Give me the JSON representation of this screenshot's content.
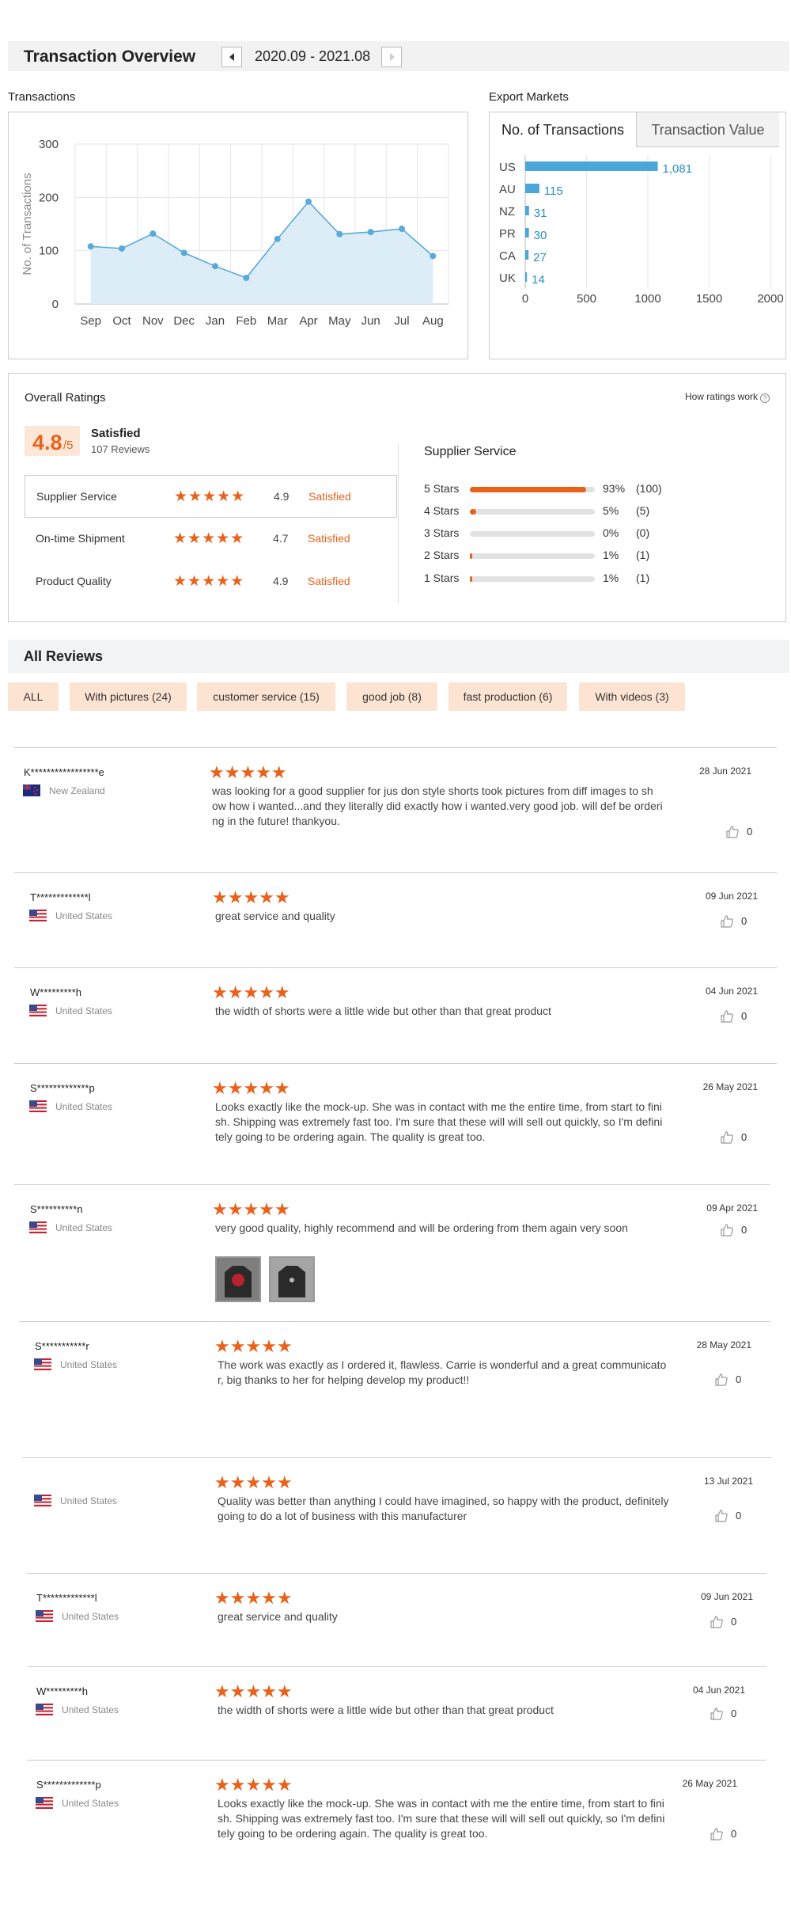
{
  "overview": {
    "title": "Transaction Overview",
    "range": "2020.09 - 2021.08"
  },
  "transactions": {
    "label": "Transactions",
    "chart_data": {
      "type": "area",
      "ylabel": "No. of Transactions",
      "xlabel": "",
      "categories": [
        "Sep",
        "Oct",
        "Nov",
        "Dec",
        "Jan",
        "Feb",
        "Mar",
        "Apr",
        "May",
        "Jun",
        "Jul",
        "Aug"
      ],
      "values": [
        108,
        104,
        132,
        96,
        71,
        49,
        122,
        192,
        131,
        135,
        141,
        90
      ],
      "yticks": [
        "0",
        "100",
        "200",
        "300"
      ],
      "ylim": [
        0,
        300
      ],
      "grid": true,
      "color": "#5aaad8",
      "fill": "#dcedf8"
    }
  },
  "export": {
    "label": "Export Markets",
    "tab_active": "No. of Transactions",
    "tab_inactive": "Transaction Value",
    "chart_data": {
      "type": "bar",
      "orientation": "horizontal",
      "categories": [
        "US",
        "AU",
        "NZ",
        "PR",
        "CA",
        "UK"
      ],
      "values": [
        1081,
        115,
        31,
        30,
        27,
        14
      ],
      "value_labels": [
        "1,081",
        "115",
        "31",
        "30",
        "27",
        "14"
      ],
      "xticks": [
        "0",
        "500",
        "1000",
        "1500",
        "2000"
      ],
      "xlim": [
        0,
        2000
      ],
      "color": "#4aa7d8"
    }
  },
  "ratings": {
    "title": "Overall Ratings",
    "how_link": "How ratings work",
    "help_icon": "?",
    "score": "4.8",
    "score_denominator": "/5",
    "satisfaction": "Satisfied",
    "review_count": "107 Reviews",
    "categories": [
      {
        "name": "Supplier Service",
        "score": "4.9",
        "label": "Satisfied",
        "stars": "★★★★★",
        "rating": 4.9
      },
      {
        "name": "On-time Shipment",
        "score": "4.7",
        "label": "Satisfied",
        "stars": "★★★★★",
        "rating": 4.7
      },
      {
        "name": "Product Quality",
        "score": "4.9",
        "label": "Satisfied",
        "stars": "★★★★★",
        "rating": 4.9
      }
    ],
    "supplier_title": "Supplier Service",
    "distribution": [
      {
        "label": "5 Stars",
        "pct": "93%",
        "count": "(100)",
        "fraction": 0.93
      },
      {
        "label": "4 Stars",
        "pct": "5%",
        "count": "(5)",
        "fraction": 0.05
      },
      {
        "label": "3 Stars",
        "pct": "0%",
        "count": "(0)",
        "fraction": 0.0
      },
      {
        "label": "2 Stars",
        "pct": "1%",
        "count": "(1)",
        "fraction": 0.01
      },
      {
        "label": "1 Stars",
        "pct": "1%",
        "count": "(1)",
        "fraction": 0.01
      }
    ]
  },
  "reviews_section": {
    "title": "All Reviews",
    "filters": [
      "ALL",
      "With pictures (24)",
      "customer service (15)",
      "good job (8)",
      "fast production (6)",
      "With videos (3)"
    ]
  },
  "reviews": [
    {
      "name": "K*****************e",
      "country": "New Zealand",
      "flag": "nz-flag",
      "stars": "★★★★★",
      "date": "28 Jun 2021",
      "likes": "0",
      "lines": [
        "was looking for a good supplier for jus don style shorts took pictures from diff images to sh",
        "ow how i wanted...and they literally did exactly how i wanted.very good job. will def be orderi",
        "ng in the future! thankyou."
      ]
    },
    {
      "name": "T*************l",
      "country": "United States",
      "flag": "us-flag",
      "stars": "★★★★★",
      "date": "09 Jun 2021",
      "likes": "0",
      "lines": [
        "great service and quality"
      ]
    },
    {
      "name": "W*********h",
      "country": "United States",
      "flag": "us-flag",
      "stars": "★★★★★",
      "date": "04 Jun 2021",
      "likes": "0",
      "lines": [
        "the width of shorts were a little wide but other than that great product"
      ]
    },
    {
      "name": "S*************p",
      "country": "United States",
      "flag": "us-flag",
      "stars": "★★★★★",
      "date": "26 May 2021",
      "likes": "0",
      "lines": [
        "Looks exactly like the mock-up. She was in contact with me the entire time, from start to fini",
        "sh. Shipping was extremely fast too. I'm sure that these will will sell out quickly, so I'm defini",
        "tely going to be ordering again. The quality is great too."
      ]
    },
    {
      "name": "S**********n",
      "country": "United States",
      "flag": "us-flag",
      "stars": "★★★★★",
      "date": "09 Apr 2021",
      "likes": "0",
      "lines": [
        "very good quality, highly recommend and will be ordering from them again very soon"
      ]
    },
    {
      "name": "S***********r",
      "country": "United States",
      "flag": "us-flag",
      "stars": "★★★★★",
      "date": "28 May 2021",
      "likes": "0",
      "lines": [
        "The work was exactly as I ordered it, flawless. Carrie is wonderful and a great communicato",
        "r, big thanks to her for helping develop my product!!"
      ]
    },
    {
      "name": "",
      "country": "United States",
      "flag": "us-flag",
      "stars": "★★★★★",
      "date": "13 Jul 2021",
      "likes": "0",
      "lines": [
        "Quality was better than anything I could have imagined, so happy with the product, definitely",
        "going to do a lot of business with this manufacturer"
      ]
    },
    {
      "name": "T*************l",
      "country": "United States",
      "flag": "us-flag",
      "stars": "★★★★★",
      "date": "09 Jun 2021",
      "likes": "0",
      "lines": [
        "great service and quality"
      ]
    },
    {
      "name": "W*********h",
      "country": "United States",
      "flag": "us-flag",
      "stars": "★★★★★",
      "date": "04 Jun 2021",
      "likes": "0",
      "lines": [
        "the width of shorts were a little wide but other than that great product"
      ]
    },
    {
      "name": "S*************p",
      "country": "United States",
      "flag": "us-flag",
      "stars": "★★★★★",
      "date": "26 May 2021",
      "likes": "0",
      "lines": [
        "Looks exactly like the mock-up. She was in contact with me the entire time, from start to fini",
        "sh. Shipping was extremely fast too. I'm sure that these will will sell out quickly, so I'm defini",
        "tely going to be ordering again. The quality is great too."
      ]
    }
  ]
}
